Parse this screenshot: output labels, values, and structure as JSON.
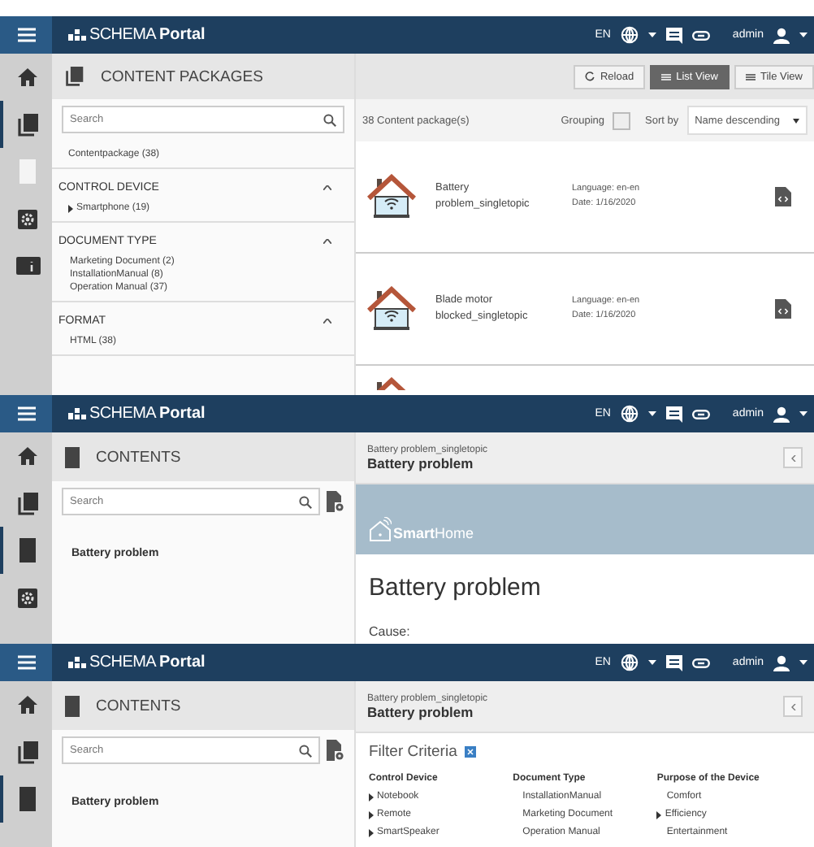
{
  "screens": [
    {
      "kind": "packages",
      "header": {
        "logo_light": "SCHEMA",
        "logo_bold": "Portal",
        "language": "EN",
        "user": "admin"
      },
      "nav": [
        {
          "kind": "home",
          "selected": false
        },
        {
          "kind": "packages",
          "selected": true
        },
        {
          "kind": "book",
          "selected": false
        },
        {
          "kind": "settings",
          "selected": false
        },
        {
          "kind": "info",
          "selected": false
        }
      ],
      "panel_title": "CONTENT PACKAGES",
      "toolbar": [
        {
          "kind": "reload",
          "label": "Reload",
          "selected": false
        },
        {
          "kind": "list",
          "label": "List View",
          "selected": true
        },
        {
          "kind": "tile",
          "label": "Tile View",
          "selected": false
        }
      ],
      "search": {
        "placeholder": "Search"
      },
      "filters": [
        {
          "items": [
            {
              "label": "Contentpackage (38)",
              "expandable": false
            }
          ]
        },
        {
          "heading": "CONTROL DEVICE",
          "expanded": true,
          "items": [
            {
              "label": "Smartphone (19)",
              "expandable": true
            }
          ]
        },
        {
          "heading": "DOCUMENT TYPE",
          "expanded": true,
          "items": [
            {
              "label": "Marketing Document (2)",
              "expandable": false
            },
            {
              "label": "InstallationManual (8)",
              "expandable": false
            },
            {
              "label": "Operation Manual (37)",
              "expandable": false
            }
          ]
        },
        {
          "heading": "FORMAT",
          "expanded": true,
          "items": [
            {
              "label": "HTML (38)",
              "expandable": false
            }
          ]
        }
      ],
      "count": "38 Content package(s)",
      "grouping": {
        "label": "Grouping",
        "checked": false
      },
      "sort": {
        "label": "Sort by",
        "value": "Name descending"
      },
      "items": [
        {
          "title": "Battery problem_singletopic",
          "language": "Language: en-en",
          "date": "Date: 1/16/2020"
        },
        {
          "title": "Blade motor blocked_singletopic",
          "language": "Language: en-en",
          "date": "Date: 1/16/2020"
        }
      ]
    },
    {
      "kind": "document",
      "header": {
        "logo_light": "SCHEMA",
        "logo_bold": "Portal",
        "language": "EN",
        "user": "admin"
      },
      "nav": [
        {
          "kind": "home",
          "selected": false
        },
        {
          "kind": "packages",
          "selected": false
        },
        {
          "kind": "book",
          "selected": true
        },
        {
          "kind": "settings",
          "selected": false
        }
      ],
      "panel_title": "CONTENTS",
      "search": {
        "placeholder": "Search"
      },
      "toc": [
        "Battery problem"
      ],
      "breadcrumb": "Battery problem_singletopic",
      "title": "Battery problem",
      "banner": {
        "bold": "Smart",
        "light": "Home"
      },
      "heading": "Battery problem",
      "body": "Cause:"
    },
    {
      "kind": "filter",
      "header": {
        "logo_light": "SCHEMA",
        "logo_bold": "Portal",
        "language": "EN",
        "user": "admin"
      },
      "nav": [
        {
          "kind": "home",
          "selected": false
        },
        {
          "kind": "packages",
          "selected": false
        },
        {
          "kind": "book",
          "selected": true
        }
      ],
      "panel_title": "CONTENTS",
      "search": {
        "placeholder": "Search"
      },
      "toc": [
        "Battery problem"
      ],
      "breadcrumb": "Battery problem_singletopic",
      "title": "Battery problem",
      "filter": {
        "title": "Filter Criteria",
        "columns": [
          {
            "heading": "Control Device",
            "items": [
              {
                "label": "Notebook",
                "expandable": true
              },
              {
                "label": "Remote",
                "expandable": true
              },
              {
                "label": "SmartSpeaker",
                "expandable": true
              }
            ]
          },
          {
            "heading": "Document Type",
            "items": [
              {
                "label": "InstallationManual",
                "expandable": false
              },
              {
                "label": "Marketing Document",
                "expandable": false
              },
              {
                "label": "Operation Manual",
                "expandable": false
              }
            ]
          },
          {
            "heading": "Purpose of the Device",
            "items": [
              {
                "label": "Comfort",
                "expandable": false
              },
              {
                "label": "Efficiency",
                "expandable": true
              },
              {
                "label": "Entertainment",
                "expandable": false
              }
            ]
          }
        ]
      }
    }
  ]
}
